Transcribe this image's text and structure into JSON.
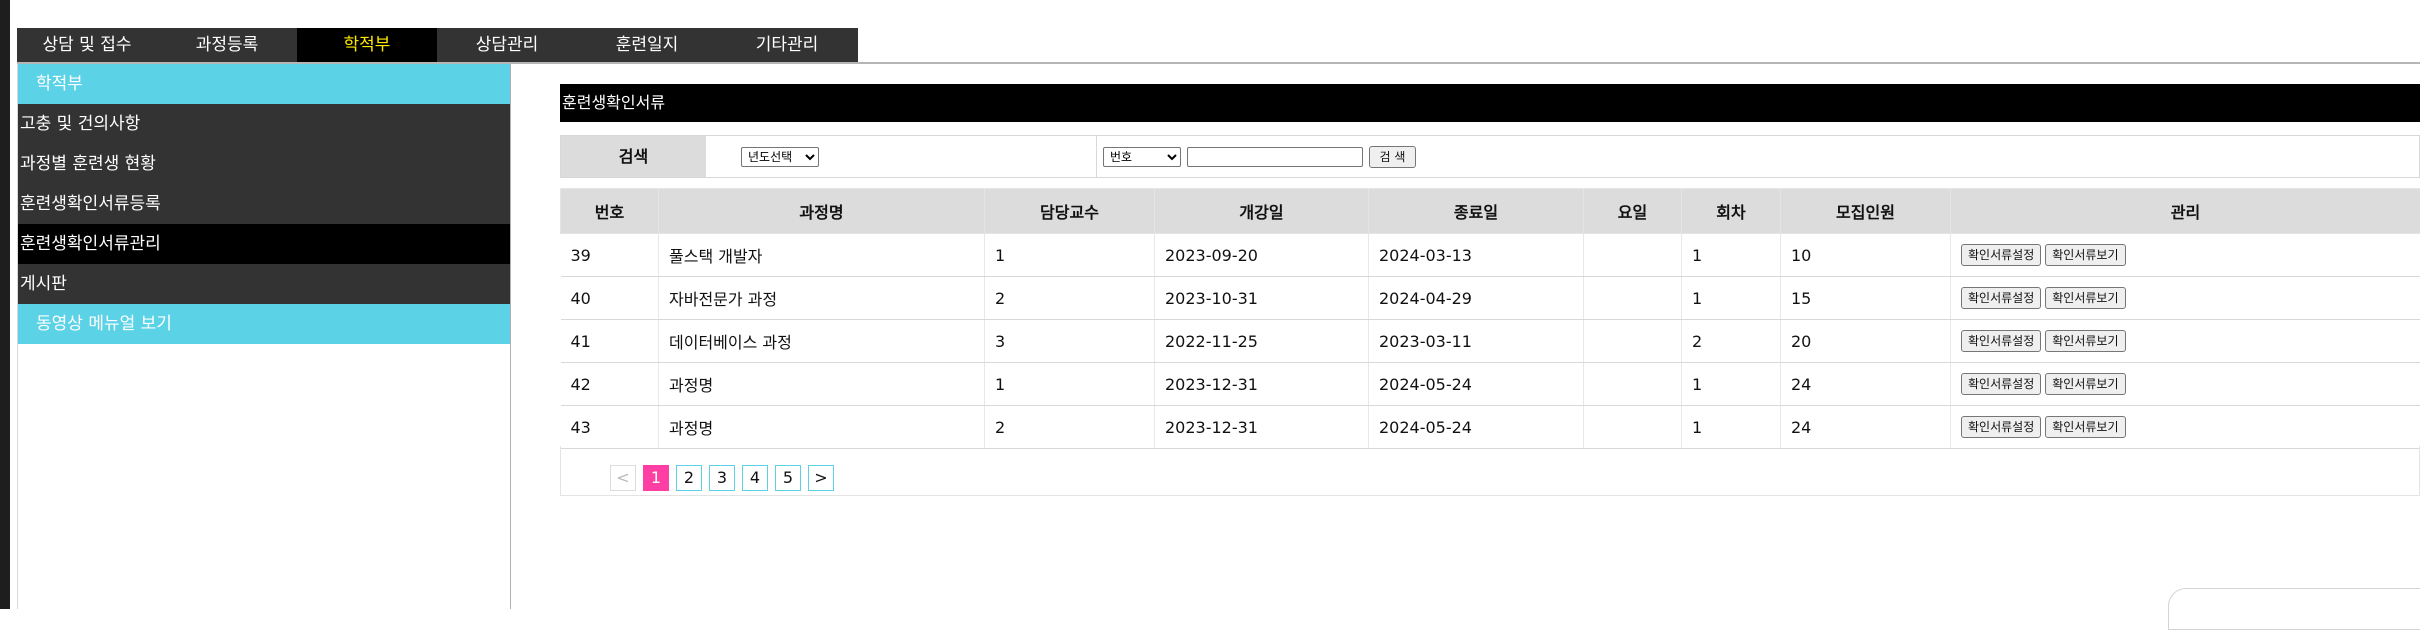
{
  "top_nav": [
    {
      "label": "상담 및 접수"
    },
    {
      "label": "과정등록"
    },
    {
      "label": "학적부",
      "active": true
    },
    {
      "label": "상담관리"
    },
    {
      "label": "훈련일지"
    },
    {
      "label": "기타관리"
    }
  ],
  "sidebar": {
    "header": "학적부",
    "items": [
      {
        "label": "고충 및 건의사항"
      },
      {
        "label": "과정별 훈련생 현황"
      },
      {
        "label": "훈련생확인서류등록"
      },
      {
        "label": "훈련생확인서류관리",
        "active": true
      },
      {
        "label": "게시판"
      }
    ],
    "video_manual": "동영상 메뉴얼 보기"
  },
  "main": {
    "section_title": "훈련생확인서류",
    "search": {
      "label": "검색",
      "year_select": "년도선택",
      "field_select": "번호",
      "input_value": "",
      "button": "검 색"
    },
    "table": {
      "columns": [
        "번호",
        "과정명",
        "담당교수",
        "개강일",
        "종료일",
        "요일",
        "회차",
        "모집인원",
        "관리"
      ],
      "rows": [
        {
          "no": "39",
          "course": "풀스택 개발자",
          "prof": "1",
          "start": "2023-09-20",
          "end": "2024-03-13",
          "day": "",
          "round": "1",
          "capacity": "10"
        },
        {
          "no": "40",
          "course": "자바전문가 과정",
          "prof": "2",
          "start": "2023-10-31",
          "end": "2024-04-29",
          "day": "",
          "round": "1",
          "capacity": "15"
        },
        {
          "no": "41",
          "course": "데이터베이스 과정",
          "prof": "3",
          "start": "2022-11-25",
          "end": "2023-03-11",
          "day": "",
          "round": "2",
          "capacity": "20"
        },
        {
          "no": "42",
          "course": "과정명",
          "prof": "1",
          "start": "2023-12-31",
          "end": "2024-05-24",
          "day": "",
          "round": "1",
          "capacity": "24"
        },
        {
          "no": "43",
          "course": "과정명",
          "prof": "2",
          "start": "2023-12-31",
          "end": "2024-05-24",
          "day": "",
          "round": "1",
          "capacity": "24"
        }
      ],
      "action_setting": "확인서류설정",
      "action_view": "확인서류보기"
    },
    "pagination": {
      "prev": "<",
      "pages": [
        "1",
        "2",
        "3",
        "4",
        "5"
      ],
      "current": "1",
      "next": ">"
    }
  },
  "colors": {
    "nav_bg": "#333333",
    "nav_active_bg": "#000000",
    "nav_active_text": "#ffe800",
    "sidebar_cyan": "#5bd2e6",
    "page_active": "#ff3fa4"
  }
}
